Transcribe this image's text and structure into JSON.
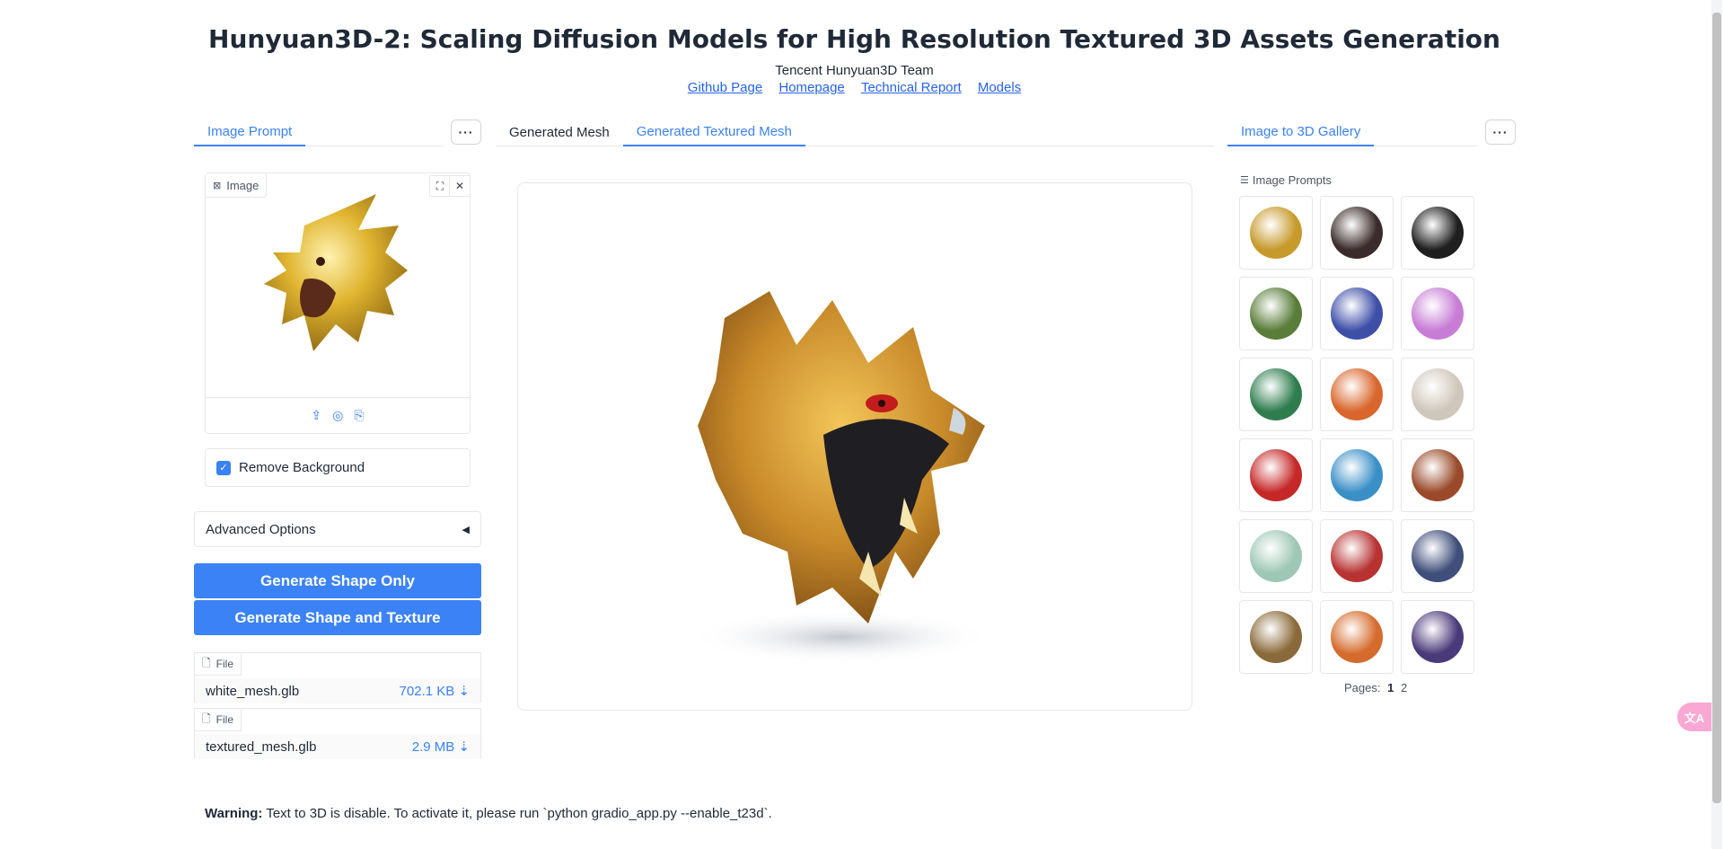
{
  "header": {
    "title": "Hunyuan3D-2: Scaling Diffusion Models for High Resolution Textured 3D Assets Generation",
    "subtitle": "Tencent Hunyuan3D Team",
    "links": [
      "Github Page",
      "Homepage",
      "Technical Report",
      "Models"
    ]
  },
  "left_panel": {
    "tab": "Image Prompt",
    "image_label": "Image",
    "remove_background_label": "Remove Background",
    "remove_background_checked": true,
    "advanced_options_label": "Advanced Options",
    "advanced_arrow": "◀",
    "generate_shape_label": "Generate Shape Only",
    "generate_texture_label": "Generate Shape and Texture",
    "files": [
      {
        "label": "File",
        "name": "white_mesh.glb",
        "size": "702.1 KB ⇣"
      },
      {
        "label": "File",
        "name": "textured_mesh.glb",
        "size": "2.9 MB ⇣"
      }
    ]
  },
  "center_panel": {
    "tabs": [
      "Generated Mesh",
      "Generated Textured Mesh"
    ],
    "active_tab": 1
  },
  "right_panel": {
    "tab": "Image to 3D Gallery",
    "gallery_label": "Image Prompts",
    "thumbnails": [
      {
        "icon": "golden-dragon-icon",
        "color": "#c79a2c"
      },
      {
        "icon": "shield-icon",
        "color": "#3b2b2b"
      },
      {
        "icon": "penguin-icon",
        "color": "#1f1f1f"
      },
      {
        "icon": "tree-icon",
        "color": "#5a7d3a"
      },
      {
        "icon": "house-icon",
        "color": "#3e4fa8"
      },
      {
        "icon": "christmas-tree-icon",
        "color": "#c77dd6"
      },
      {
        "icon": "jade-pendant-icon",
        "color": "#2f7d4f"
      },
      {
        "icon": "pirate-figure-icon",
        "color": "#d9662c"
      },
      {
        "icon": "statue-head-icon",
        "color": "#cfc7bb"
      },
      {
        "icon": "santa-icon",
        "color": "#c62828"
      },
      {
        "icon": "seahorse-icon",
        "color": "#3a8fc7"
      },
      {
        "icon": "train-icon",
        "color": "#9a4a2a"
      },
      {
        "icon": "car-icon",
        "color": "#9ec7b5"
      },
      {
        "icon": "horse-icon",
        "color": "#b83232"
      },
      {
        "icon": "revolver-icon",
        "color": "#3f4e7a"
      },
      {
        "icon": "staff-icon",
        "color": "#8a6a3a"
      },
      {
        "icon": "bird-icon",
        "color": "#d56b2c"
      },
      {
        "icon": "witch-hat-icon",
        "color": "#4b3a7a"
      }
    ],
    "pages_label": "Pages:",
    "pages": [
      "1",
      "2"
    ],
    "current_page": "1"
  },
  "warning": {
    "label": "Warning:",
    "text": "Text to 3D is disable. To activate it, please run `python gradio_app.py --enable_t23d`."
  },
  "float_button": "文A"
}
